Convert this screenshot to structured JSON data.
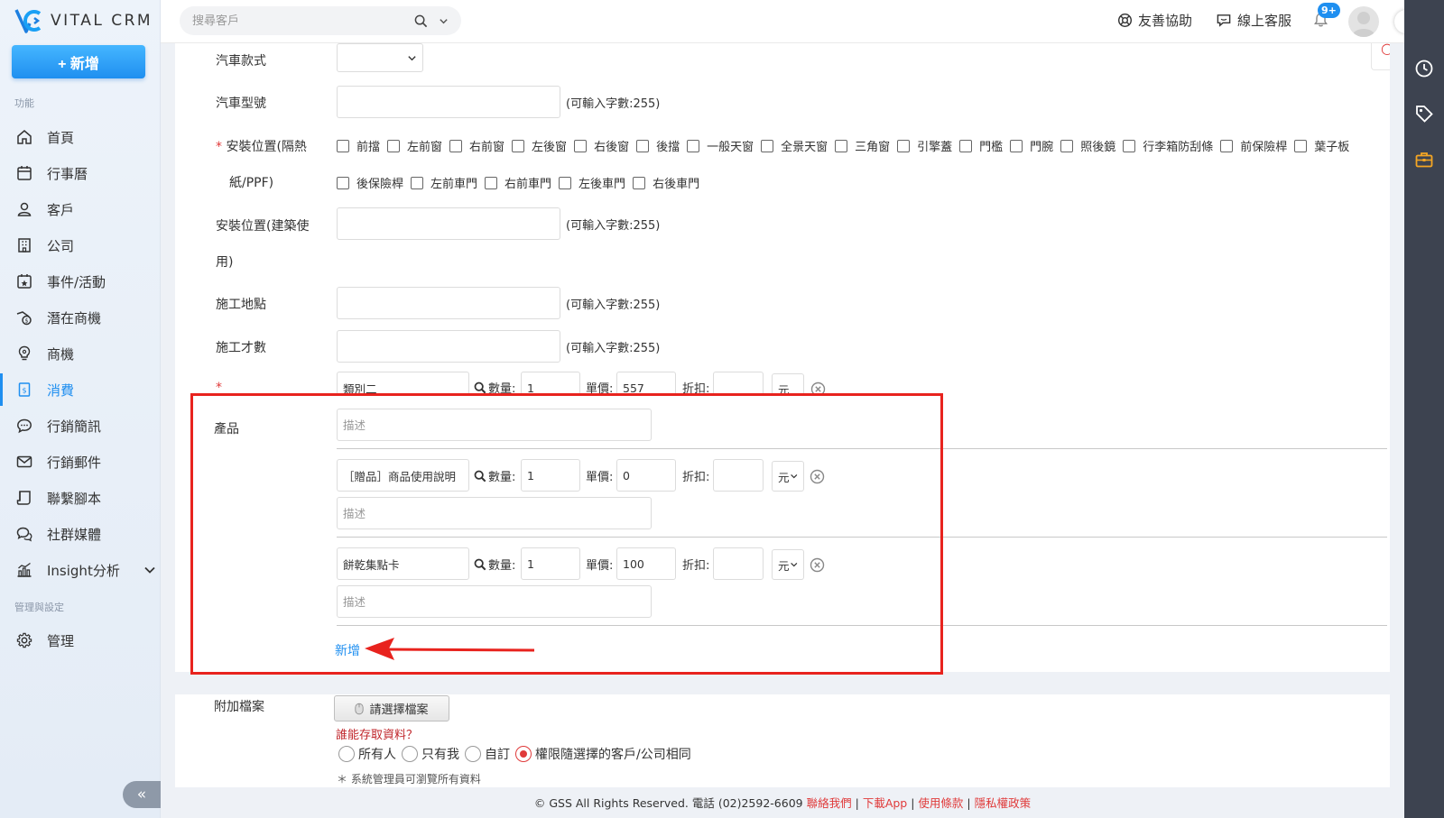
{
  "app": {
    "logo_text": "VITAL CRM"
  },
  "sidebar": {
    "new_button": "+ 新增",
    "section_features": "功能",
    "section_admin": "管理與設定",
    "items": [
      {
        "label": "首頁",
        "icon": "home-icon"
      },
      {
        "label": "行事曆",
        "icon": "calendar-icon"
      },
      {
        "label": "客戶",
        "icon": "user-icon"
      },
      {
        "label": "公司",
        "icon": "building-icon"
      },
      {
        "label": "事件/活動",
        "icon": "event-icon"
      },
      {
        "label": "潛在商機",
        "icon": "lead-icon"
      },
      {
        "label": "商機",
        "icon": "lightbulb-icon"
      },
      {
        "label": "消費",
        "icon": "receipt-icon",
        "active": true
      },
      {
        "label": "行銷簡訊",
        "icon": "sms-icon"
      },
      {
        "label": "行銷郵件",
        "icon": "mail-icon"
      },
      {
        "label": "聯繫腳本",
        "icon": "script-icon"
      },
      {
        "label": "社群媒體",
        "icon": "chat-icon"
      },
      {
        "label": "Insight分析",
        "icon": "chart-icon"
      }
    ],
    "admin_item": {
      "label": "管理",
      "icon": "gear-icon"
    },
    "collapse": "«"
  },
  "topbar": {
    "search_placeholder": "搜尋客戶",
    "help_label": "友善協助",
    "support_label": "線上客服",
    "notification_badge": "9+"
  },
  "form": {
    "car_style_label": "汽車款式",
    "car_model_label": "汽車型號",
    "install_pos_label_1": "安裝位置(隔熱",
    "install_pos_label_2": "紙/PPF)",
    "install_pos_options": [
      "前擋",
      "左前窗",
      "右前窗",
      "左後窗",
      "右後窗",
      "後擋",
      "一般天窗",
      "全景天窗",
      "三角窗",
      "引擎蓋",
      "門檻",
      "門腕",
      "照後鏡",
      "行李箱防刮條",
      "前保險桿",
      "葉子板",
      "後保險桿",
      "左前車門",
      "右前車門",
      "左後車門",
      "右後車門"
    ],
    "install_pos_building_label_1": "安裝位置(建築使",
    "install_pos_building_label_2": "用)",
    "site_label": "施工地點",
    "area_label": "施工才數",
    "char_hint": "(可輸入字數:255)",
    "required_mark": "*",
    "product_label": "產品",
    "qty_label": "數量:",
    "price_label": "單價:",
    "discount_label": "折扣:",
    "unit": "元",
    "desc_placeholder": "描述",
    "products": [
      {
        "name": "類別二",
        "qty": "1",
        "price": "557"
      },
      {
        "name": "［贈品］商品使用說明",
        "qty": "1",
        "price": "0"
      },
      {
        "name": "餅乾集點卡",
        "qty": "1",
        "price": "100"
      }
    ],
    "add_link": "新增",
    "attach_label": "附加檔案",
    "file_button": "請選擇檔案",
    "access_question": "誰能存取資料？",
    "access_options": [
      {
        "label": "所有人",
        "checked": false
      },
      {
        "label": "只有我",
        "checked": false
      },
      {
        "label": "自訂",
        "checked": false
      },
      {
        "label": "權限隨選擇的客戶/公司相同",
        "checked": true
      }
    ],
    "admin_note": "＊ 系統管理員可瀏覽所有資料"
  },
  "footer": {
    "copyright": "© GSS All Rights Reserved. 電話 (02)2592-6609",
    "contact": "聯絡我們",
    "download": "下載App",
    "terms": "使用條款",
    "privacy": "隱私權政策",
    "sep": "|"
  },
  "colors": {
    "accent": "#1f8ff0",
    "highlight": "#e8231e",
    "rail": "#3d4350"
  }
}
